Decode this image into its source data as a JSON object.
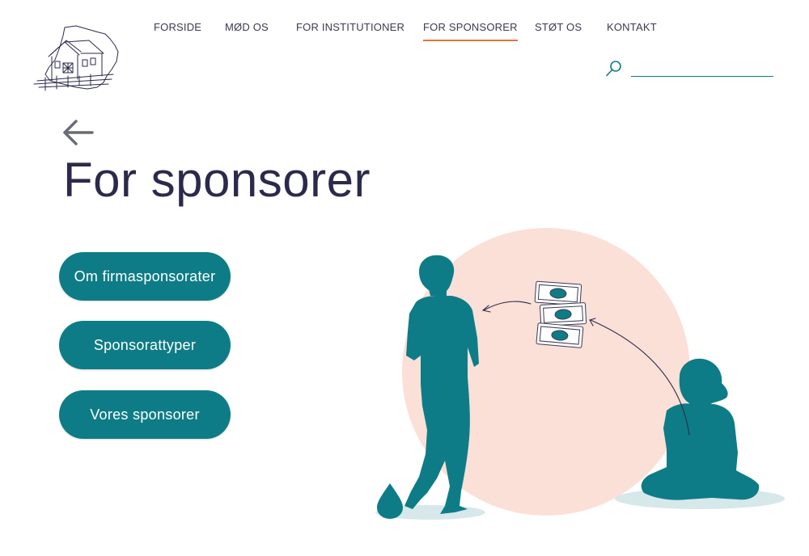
{
  "header": {
    "nav": [
      {
        "label": "FORSIDE"
      },
      {
        "label": "MØD OS"
      },
      {
        "label": "FOR INSTITUTIONER"
      },
      {
        "label": "FOR SPONSORER"
      },
      {
        "label": "STØT OS"
      },
      {
        "label": "KONTAKT"
      }
    ],
    "active_index": 3,
    "search": {
      "placeholder": "",
      "value": ""
    }
  },
  "main": {
    "title": "For sponsorer",
    "buttons": [
      {
        "label": "Om firmasponsorater"
      },
      {
        "label": "Sponsorattyper"
      },
      {
        "label": "Vores sponsorer"
      }
    ]
  },
  "colors": {
    "teal": "#0e7c86",
    "accent_underline": "#e2743a",
    "circle": "#fbe0d8",
    "text": "#2b2a4c"
  },
  "icons": {
    "logo": "house-sketch-logo",
    "search": "magnifier-icon",
    "back": "arrow-left-icon"
  }
}
